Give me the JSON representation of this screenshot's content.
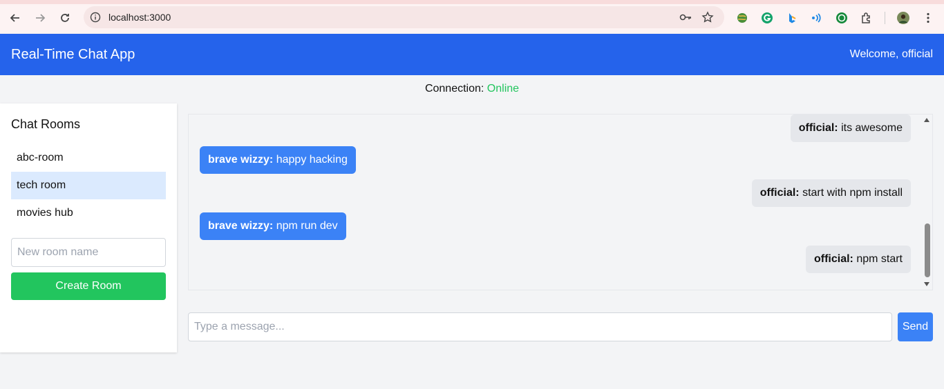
{
  "browser": {
    "url": "localhost:3000",
    "icons": [
      "back-icon",
      "forward-icon",
      "reload-icon",
      "site-info-icon",
      "key-icon",
      "star-icon",
      "extensions-icon",
      "profile-avatar",
      "menu-icon"
    ]
  },
  "header": {
    "title": "Real-Time Chat App",
    "welcome": "Welcome, official"
  },
  "connection": {
    "label": "Connection:",
    "status": "Online",
    "status_color": "#22c55e"
  },
  "sidebar": {
    "title": "Chat Rooms",
    "rooms": [
      {
        "label": "abc-room",
        "active": false
      },
      {
        "label": "tech room",
        "active": true
      },
      {
        "label": "movies hub",
        "active": false
      }
    ],
    "new_room_placeholder": "New room name",
    "create_label": "Create Room"
  },
  "messages": [
    {
      "sender": "official:",
      "text": "its awesome",
      "own": true
    },
    {
      "sender": "brave wizzy:",
      "text": "happy hacking",
      "own": false
    },
    {
      "sender": "official:",
      "text": "start with npm install",
      "own": true
    },
    {
      "sender": "brave wizzy:",
      "text": "npm run dev",
      "own": false
    },
    {
      "sender": "official:",
      "text": "npm start",
      "own": true
    }
  ],
  "composer": {
    "placeholder": "Type a message...",
    "send_label": "Send"
  },
  "colors": {
    "header": "#2563eb",
    "create_button": "#22c55e",
    "send_button": "#3b82f6",
    "other_message": "#3b82f6",
    "own_message": "#e5e7eb",
    "active_room": "#dbeafe"
  }
}
